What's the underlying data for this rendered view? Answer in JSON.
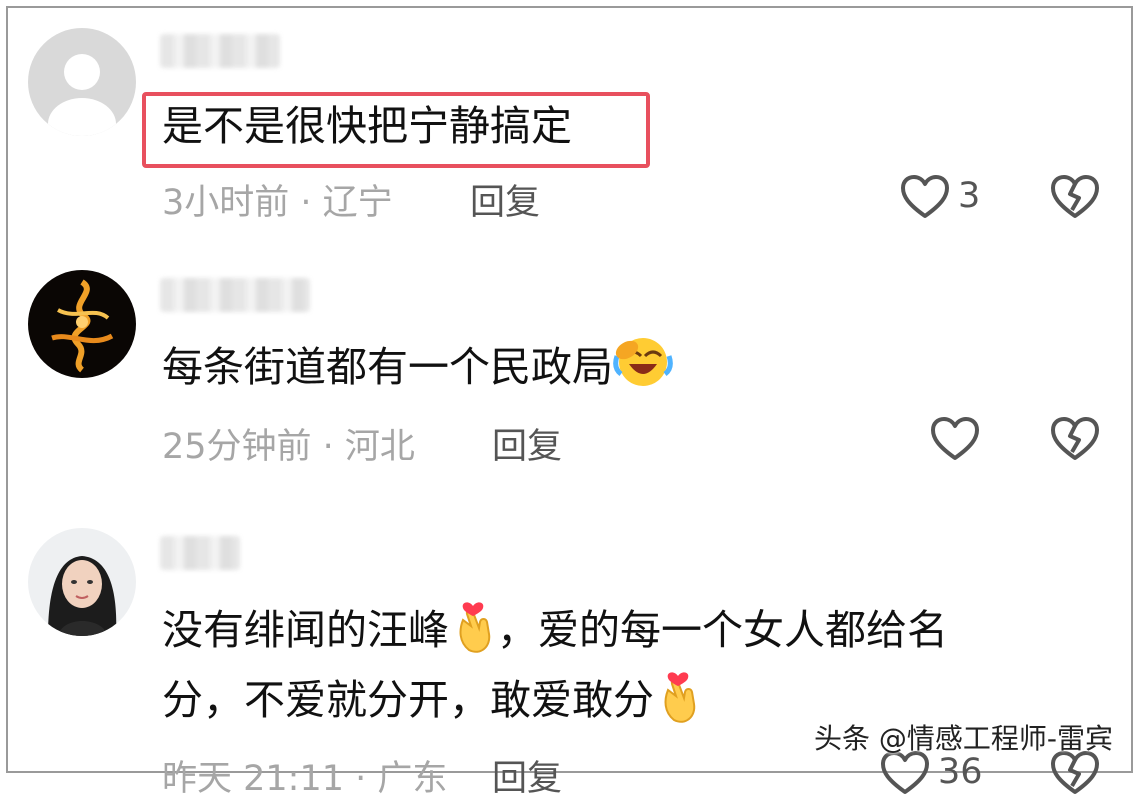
{
  "comments": [
    {
      "text": "是不是很快把宁静搞定",
      "meta": "3小时前 · 辽宁",
      "reply": "回复",
      "likes": "3"
    },
    {
      "text": "每条街道都有一个民政局",
      "meta": "25分钟前 · 河北",
      "reply": "回复"
    },
    {
      "line1": "没有绯闻的汪峰",
      "line1b": "，爱的每一个女人都给名",
      "line2": "分，不爱就分开，敢爱敢分",
      "meta": "昨天 21:11 · 广东",
      "reply": "回复",
      "likes": "36"
    }
  ],
  "watermark": "头条 @情感工程师-雷宾",
  "colors": {
    "highlight": "#e8505e",
    "meta_text": "#a6a6a6",
    "icon_stroke": "#555555"
  }
}
